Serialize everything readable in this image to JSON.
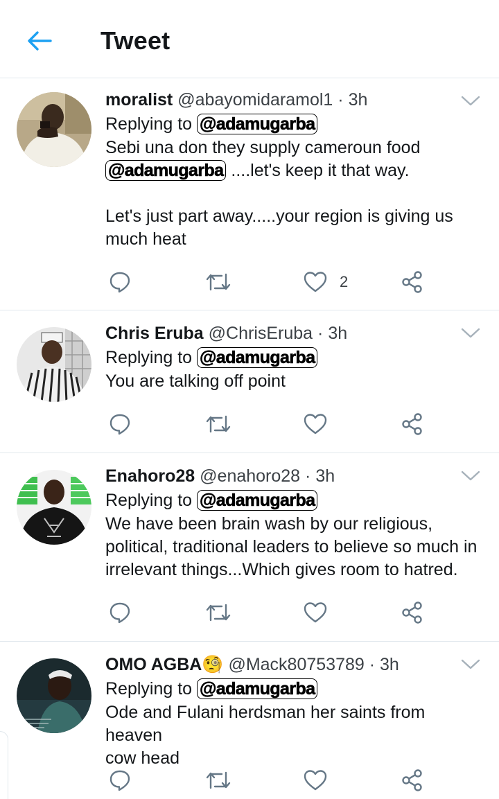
{
  "header": {
    "title": "Tweet",
    "back_icon": "arrow-left-icon",
    "accent": "#1da1f2"
  },
  "tweets": [
    {
      "name": "moralist",
      "handle": "@abayomidaramol1",
      "time": "3h",
      "replying_prefix": "Replying to",
      "replying_to": "@adamugarba",
      "lines": [
        [
          "",
          "Sebi una don they supply cameroun food"
        ],
        [
          "@adamugarba",
          " ....let's keep it that way."
        ],
        [
          "",
          ""
        ],
        [
          "",
          "Let's just part away.....your region is giving us"
        ],
        [
          "",
          "much heat"
        ]
      ],
      "likes": "2"
    },
    {
      "name": "Chris Eruba",
      "handle": "@ChrisEruba",
      "time": "3h",
      "replying_prefix": "Replying to",
      "replying_to": "@adamugarba",
      "text": "You are talking off point",
      "likes": ""
    },
    {
      "name": "Enahoro28",
      "handle": "@enahoro28",
      "time": "3h",
      "replying_prefix": "Replying to",
      "replying_to": "@adamugarba",
      "text_lines": [
        "We have been brain wash by our religious,",
        "political, traditional leaders to believe so much in",
        "irrelevant things...Which gives room to hatred."
      ],
      "likes": ""
    },
    {
      "name": "OMO AGBA",
      "name_emoji": "🧐",
      "handle": "@Mack80753789",
      "time": "3h",
      "replying_prefix": "Replying to",
      "replying_to": "@adamugarba",
      "text_lines": [
        "Ode and Fulani herdsman her saints from heaven",
        "cow head"
      ],
      "likes": ""
    }
  ],
  "separator": "·",
  "icons": {
    "reply": "reply-icon",
    "retweet": "retweet-icon",
    "like": "heart-icon",
    "share": "share-icon",
    "more": "chevron-down-icon"
  },
  "colors": {
    "icon_gray": "#657786",
    "divider": "#e1e8ed",
    "text": "#14171a"
  }
}
